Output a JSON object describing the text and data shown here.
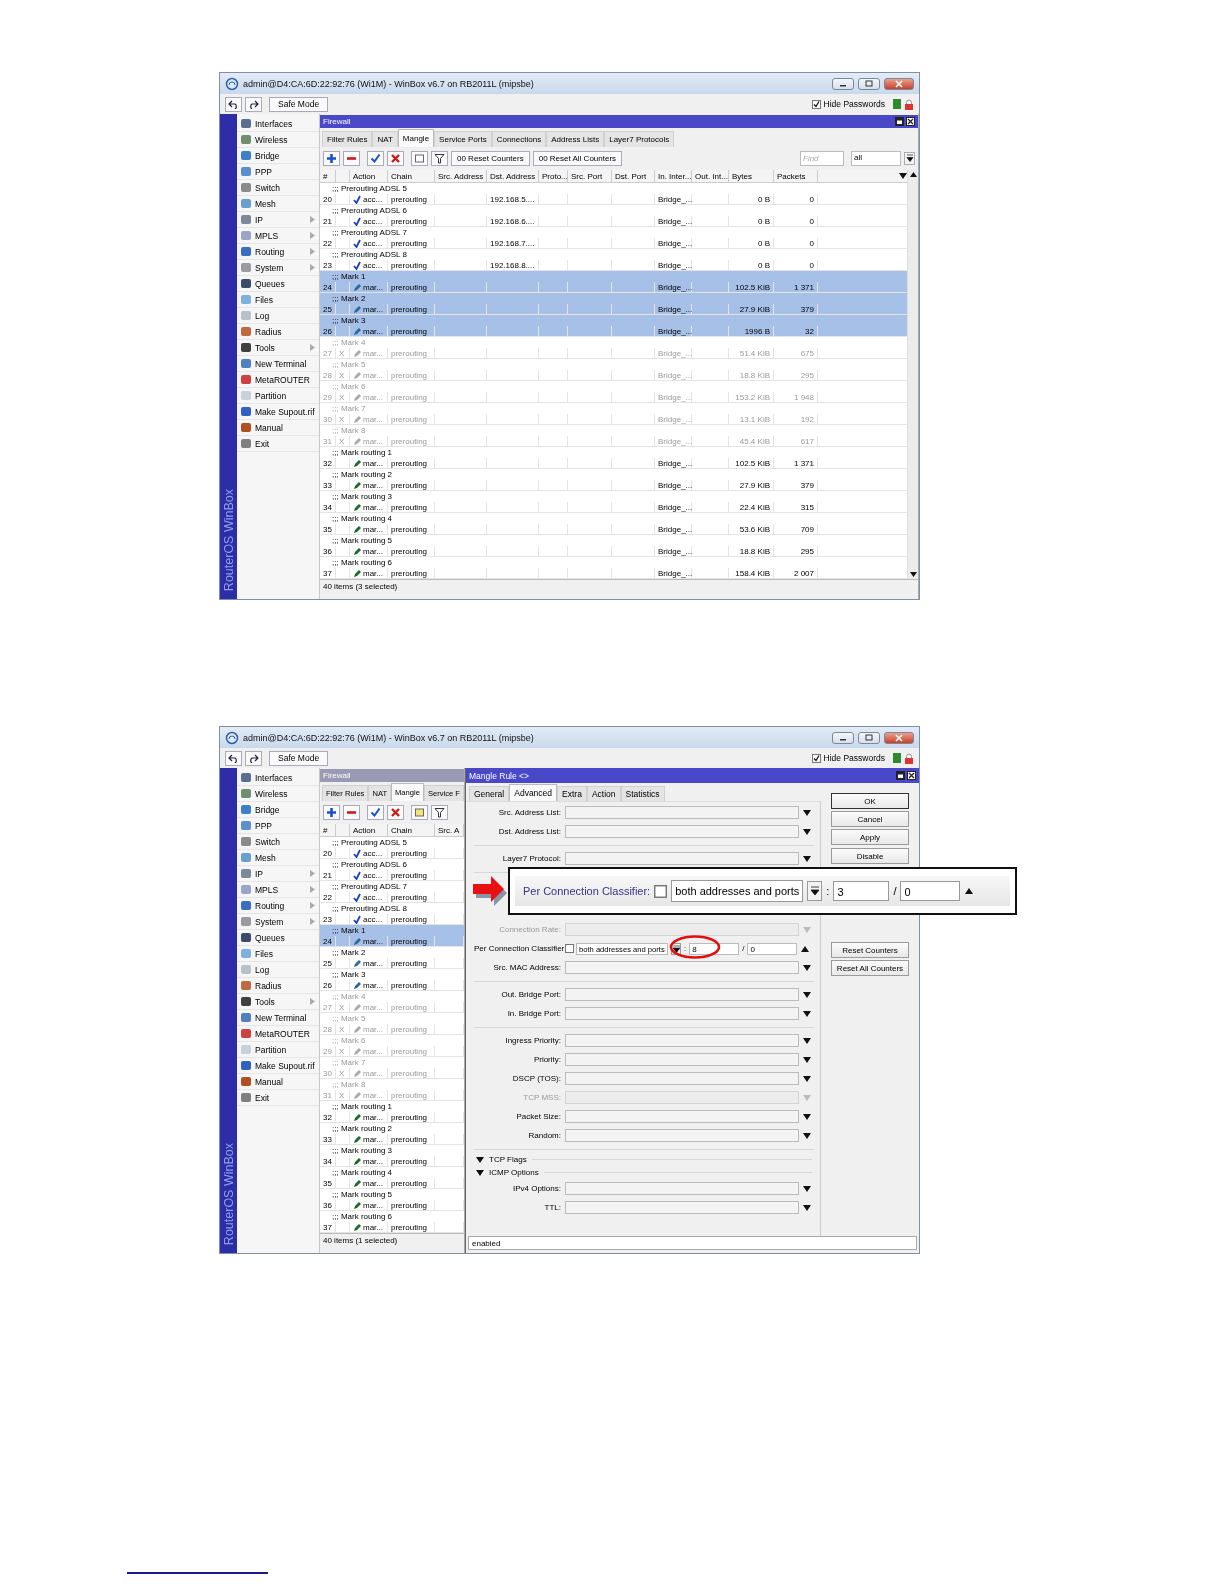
{
  "screenshots": [
    {
      "window": {
        "title": "admin@D4:CA:6D:22:92:76 (Wi1M) - WinBox v6.7 on RB2011L (mipsbe)"
      },
      "toolbar": {
        "safe_mode": "Safe Mode",
        "hide_passwords": {
          "label": "Hide Passwords",
          "checked": true
        }
      },
      "brand": "RouterOS WinBox",
      "menu": [
        {
          "label": "Interfaces",
          "submenu": false
        },
        {
          "label": "Wireless",
          "submenu": false
        },
        {
          "label": "Bridge",
          "submenu": false
        },
        {
          "label": "PPP",
          "submenu": false
        },
        {
          "label": "Switch",
          "submenu": false
        },
        {
          "label": "Mesh",
          "submenu": false
        },
        {
          "label": "IP",
          "submenu": true
        },
        {
          "label": "MPLS",
          "submenu": true
        },
        {
          "label": "Routing",
          "submenu": true
        },
        {
          "label": "System",
          "submenu": true
        },
        {
          "label": "Queues",
          "submenu": false
        },
        {
          "label": "Files",
          "submenu": false
        },
        {
          "label": "Log",
          "submenu": false
        },
        {
          "label": "Radius",
          "submenu": false
        },
        {
          "label": "Tools",
          "submenu": true
        },
        {
          "label": "New Terminal",
          "submenu": false
        },
        {
          "label": "MetaROUTER",
          "submenu": false
        },
        {
          "label": "Partition",
          "submenu": false
        },
        {
          "label": "Make Supout.rif",
          "submenu": false
        },
        {
          "label": "Manual",
          "submenu": false
        },
        {
          "label": "Exit",
          "submenu": false
        }
      ],
      "firewall": {
        "title": "Firewall",
        "active": true,
        "tabs": [
          {
            "label": "Filter Rules",
            "selected": false
          },
          {
            "label": "NAT",
            "selected": false
          },
          {
            "label": "Mangle",
            "selected": true
          },
          {
            "label": "Service Ports",
            "selected": false
          },
          {
            "label": "Connections",
            "selected": false
          },
          {
            "label": "Address Lists",
            "selected": false
          },
          {
            "label": "Layer7 Protocols",
            "selected": false
          }
        ],
        "buttons": [
          "00 Reset Counters",
          "00 Reset All Counters"
        ],
        "find": {
          "placeholder": "Find"
        },
        "filter_value": "all",
        "columns": [
          "#",
          "Action",
          "Chain",
          "Src. Address",
          "Dst. Address",
          "Proto...",
          "Src. Port",
          "Dst. Port",
          "In. Inter...",
          "Out. Int...",
          "Bytes",
          "Packets"
        ],
        "rows": [
          {
            "kind": "comment",
            "text": ";;; Prerouting ADSL 5",
            "selected": false,
            "disabled": false
          },
          {
            "kind": "accept",
            "cells": [
              "20",
              "acc...",
              "prerouting",
              null,
              "192.168.5....",
              null,
              null,
              null,
              "Bridge_...",
              null,
              "0 B",
              "0"
            ],
            "selected": false,
            "disabled": false
          },
          {
            "kind": "comment",
            "text": ";;; Prerouting ADSL 6",
            "selected": false,
            "disabled": false
          },
          {
            "kind": "accept",
            "cells": [
              "21",
              "acc...",
              "prerouting",
              null,
              "192.168.6....",
              null,
              null,
              null,
              "Bridge_...",
              null,
              "0 B",
              "0"
            ],
            "selected": false,
            "disabled": false
          },
          {
            "kind": "comment",
            "text": ";;; Prerouting ADSL 7",
            "selected": false,
            "disabled": false
          },
          {
            "kind": "accept",
            "cells": [
              "22",
              "acc...",
              "prerouting",
              null,
              "192.168.7....",
              null,
              null,
              null,
              "Bridge_...",
              null,
              "0 B",
              "0"
            ],
            "selected": false,
            "disabled": false
          },
          {
            "kind": "comment",
            "text": ";;; Prerouting ADSL 8",
            "selected": false,
            "disabled": false
          },
          {
            "kind": "accept",
            "cells": [
              "23",
              "acc...",
              "prerouting",
              null,
              "192.168.8....",
              null,
              null,
              null,
              "Bridge_...",
              null,
              "0 B",
              "0"
            ],
            "selected": false,
            "disabled": false
          },
          {
            "kind": "comment",
            "text": ";;; Mark 1",
            "selected": true,
            "disabled": false
          },
          {
            "kind": "mark-connection",
            "cells": [
              "24",
              "mar...",
              "prerouting",
              null,
              null,
              null,
              null,
              null,
              "Bridge_...",
              null,
              "102.5 KiB",
              "1 371"
            ],
            "selected": true,
            "disabled": false
          },
          {
            "kind": "comment",
            "text": ";;; Mark 2",
            "selected": true,
            "disabled": false
          },
          {
            "kind": "mark-connection",
            "cells": [
              "25",
              "mar...",
              "prerouting",
              null,
              null,
              null,
              null,
              null,
              "Bridge_...",
              null,
              "27.9 KiB",
              "379"
            ],
            "selected": true,
            "disabled": false
          },
          {
            "kind": "comment",
            "text": ";;; Mark 3",
            "selected": true,
            "disabled": false
          },
          {
            "kind": "mark-connection",
            "cells": [
              "26",
              "mar...",
              "prerouting",
              null,
              null,
              null,
              null,
              null,
              "Bridge_...",
              null,
              "1996 B",
              "32"
            ],
            "selected": true,
            "disabled": false
          },
          {
            "kind": "comment",
            "text": ";;; Mark 4",
            "selected": false,
            "disabled": true
          },
          {
            "kind": "mark-connection",
            "cells": [
              "27",
              "mar...",
              "prerouting",
              null,
              null,
              null,
              null,
              null,
              "Bridge_...",
              null,
              "51.4 KiB",
              "675"
            ],
            "flag": "X",
            "selected": false,
            "disabled": true
          },
          {
            "kind": "comment",
            "text": ";;; Mark 5",
            "selected": false,
            "disabled": true
          },
          {
            "kind": "mark-connection",
            "cells": [
              "28",
              "mar...",
              "prerouting",
              null,
              null,
              null,
              null,
              null,
              "Bridge_...",
              null,
              "18.8 KiB",
              "295"
            ],
            "flag": "X",
            "selected": false,
            "disabled": true
          },
          {
            "kind": "comment",
            "text": ";;; Mark 6",
            "selected": false,
            "disabled": true
          },
          {
            "kind": "mark-connection",
            "cells": [
              "29",
              "mar...",
              "prerouting",
              null,
              null,
              null,
              null,
              null,
              "Bridge_...",
              null,
              "153.2 KiB",
              "1 948"
            ],
            "flag": "X",
            "selected": false,
            "disabled": true
          },
          {
            "kind": "comment",
            "text": ";;; Mark 7",
            "selected": false,
            "disabled": true
          },
          {
            "kind": "mark-connection",
            "cells": [
              "30",
              "mar...",
              "prerouting",
              null,
              null,
              null,
              null,
              null,
              "Bridge_...",
              null,
              "13.1 KiB",
              "192"
            ],
            "flag": "X",
            "selected": false,
            "disabled": true
          },
          {
            "kind": "comment",
            "text": ";;; Mark 8",
            "selected": false,
            "disabled": true
          },
          {
            "kind": "mark-connection",
            "cells": [
              "31",
              "mar...",
              "prerouting",
              null,
              null,
              null,
              null,
              null,
              "Bridge_...",
              null,
              "45.4 KiB",
              "617"
            ],
            "flag": "X",
            "selected": false,
            "disabled": true
          },
          {
            "kind": "comment",
            "text": ";;; Mark routing 1",
            "selected": false,
            "disabled": false
          },
          {
            "kind": "mark-routing",
            "cells": [
              "32",
              "mar...",
              "prerouting",
              null,
              null,
              null,
              null,
              null,
              "Bridge_...",
              null,
              "102.5 KiB",
              "1 371"
            ],
            "selected": false,
            "disabled": false
          },
          {
            "kind": "comment",
            "text": ";;; Mark routing 2",
            "selected": false,
            "disabled": false
          },
          {
            "kind": "mark-routing",
            "cells": [
              "33",
              "mar...",
              "prerouting",
              null,
              null,
              null,
              null,
              null,
              "Bridge_...",
              null,
              "27.9 KiB",
              "379"
            ],
            "selected": false,
            "disabled": false
          },
          {
            "kind": "comment",
            "text": ";;; Mark routing 3",
            "selected": false,
            "disabled": false
          },
          {
            "kind": "mark-routing",
            "cells": [
              "34",
              "mar...",
              "prerouting",
              null,
              null,
              null,
              null,
              null,
              "Bridge_...",
              null,
              "22.4 KiB",
              "315"
            ],
            "selected": false,
            "disabled": false
          },
          {
            "kind": "comment",
            "text": ";;; Mark routing 4",
            "selected": false,
            "disabled": false
          },
          {
            "kind": "mark-routing",
            "cells": [
              "35",
              "mar...",
              "prerouting",
              null,
              null,
              null,
              null,
              null,
              "Bridge_...",
              null,
              "53.6 KiB",
              "709"
            ],
            "selected": false,
            "disabled": false
          },
          {
            "kind": "comment",
            "text": ";;; Mark routing 5",
            "selected": false,
            "disabled": false
          },
          {
            "kind": "mark-routing",
            "cells": [
              "36",
              "mar...",
              "prerouting",
              null,
              null,
              null,
              null,
              null,
              "Bridge_...",
              null,
              "18.8 KiB",
              "295"
            ],
            "selected": false,
            "disabled": false
          },
          {
            "kind": "comment",
            "text": ";;; Mark routing 6",
            "selected": false,
            "disabled": false
          },
          {
            "kind": "mark-routing",
            "cells": [
              "37",
              "mar...",
              "prerouting",
              null,
              null,
              null,
              null,
              null,
              "Bridge_...",
              null,
              "158.4 KiB",
              "2 007"
            ],
            "selected": false,
            "disabled": false
          }
        ],
        "status": "40 items (3 selected)"
      }
    },
    {
      "window": {
        "title": "admin@D4:CA:6D:22:92:76 (Wi1M) - WinBox v6.7 on RB2011L (mipsbe)"
      },
      "toolbar": {
        "safe_mode": "Safe Mode",
        "hide_passwords": {
          "label": "Hide Passwords",
          "checked": true
        }
      },
      "brand": "RouterOS WinBox",
      "menu": [
        {
          "label": "Interfaces",
          "submenu": false
        },
        {
          "label": "Wireless",
          "submenu": false
        },
        {
          "label": "Bridge",
          "submenu": false
        },
        {
          "label": "PPP",
          "submenu": false
        },
        {
          "label": "Switch",
          "submenu": false
        },
        {
          "label": "Mesh",
          "submenu": false
        },
        {
          "label": "IP",
          "submenu": true
        },
        {
          "label": "MPLS",
          "submenu": true
        },
        {
          "label": "Routing",
          "submenu": true
        },
        {
          "label": "System",
          "submenu": true
        },
        {
          "label": "Queues",
          "submenu": false
        },
        {
          "label": "Files",
          "submenu": false
        },
        {
          "label": "Log",
          "submenu": false
        },
        {
          "label": "Radius",
          "submenu": false
        },
        {
          "label": "Tools",
          "submenu": true
        },
        {
          "label": "New Terminal",
          "submenu": false
        },
        {
          "label": "MetaROUTER",
          "submenu": false
        },
        {
          "label": "Partition",
          "submenu": false
        },
        {
          "label": "Make Supout.rif",
          "submenu": false
        },
        {
          "label": "Manual",
          "submenu": false
        },
        {
          "label": "Exit",
          "submenu": false
        }
      ],
      "firewall": {
        "title": "Firewall",
        "active": false,
        "tabs": [
          {
            "label": "Filter Rules",
            "selected": false
          },
          {
            "label": "NAT",
            "selected": false
          },
          {
            "label": "Mangle",
            "selected": true
          },
          {
            "label": "Service F",
            "selected": false
          }
        ],
        "columns": [
          "#",
          "Action",
          "Chain",
          "Src. A"
        ],
        "rows": [
          {
            "kind": "comment",
            "text": ";;; Prerouting ADSL 5",
            "selected": false,
            "disabled": false
          },
          {
            "kind": "accept",
            "cells": [
              "20",
              "acc...",
              "prerouting",
              null
            ],
            "selected": false,
            "disabled": false
          },
          {
            "kind": "comment",
            "text": ";;; Prerouting ADSL 6",
            "selected": false,
            "disabled": false
          },
          {
            "kind": "accept",
            "cells": [
              "21",
              "acc...",
              "prerouting",
              null
            ],
            "selected": false,
            "disabled": false
          },
          {
            "kind": "comment",
            "text": ";;; Prerouting ADSL 7",
            "selected": false,
            "disabled": false
          },
          {
            "kind": "accept",
            "cells": [
              "22",
              "acc...",
              "prerouting",
              null
            ],
            "selected": false,
            "disabled": false
          },
          {
            "kind": "comment",
            "text": ";;; Prerouting ADSL 8",
            "selected": false,
            "disabled": false
          },
          {
            "kind": "accept",
            "cells": [
              "23",
              "acc...",
              "prerouting",
              null
            ],
            "selected": false,
            "disabled": false
          },
          {
            "kind": "comment",
            "text": ";;; Mark 1",
            "selected": true,
            "disabled": false
          },
          {
            "kind": "mark-connection",
            "cells": [
              "24",
              "mar...",
              "prerouting",
              null
            ],
            "selected": true,
            "disabled": false
          },
          {
            "kind": "comment",
            "text": ";;; Mark 2",
            "selected": false,
            "disabled": false
          },
          {
            "kind": "mark-connection",
            "cells": [
              "25",
              "mar...",
              "prerouting",
              null
            ],
            "selected": false,
            "disabled": false
          },
          {
            "kind": "comment",
            "text": ";;; Mark 3",
            "selected": false,
            "disabled": false
          },
          {
            "kind": "mark-connection",
            "cells": [
              "26",
              "mar...",
              "prerouting",
              null
            ],
            "selected": false,
            "disabled": false
          },
          {
            "kind": "comment",
            "text": ";;; Mark 4",
            "selected": false,
            "disabled": true
          },
          {
            "kind": "mark-connection",
            "cells": [
              "27",
              "mar...",
              "prerouting",
              null
            ],
            "flag": "X",
            "selected": false,
            "disabled": true
          },
          {
            "kind": "comment",
            "text": ";;; Mark 5",
            "selected": false,
            "disabled": true
          },
          {
            "kind": "mark-connection",
            "cells": [
              "28",
              "mar...",
              "prerouting",
              null
            ],
            "flag": "X",
            "selected": false,
            "disabled": true
          },
          {
            "kind": "comment",
            "text": ";;; Mark 6",
            "selected": false,
            "disabled": true
          },
          {
            "kind": "mark-connection",
            "cells": [
              "29",
              "mar...",
              "prerouting",
              null
            ],
            "flag": "X",
            "selected": false,
            "disabled": true
          },
          {
            "kind": "comment",
            "text": ";;; Mark 7",
            "selected": false,
            "disabled": true
          },
          {
            "kind": "mark-connection",
            "cells": [
              "30",
              "mar...",
              "prerouting",
              null
            ],
            "flag": "X",
            "selected": false,
            "disabled": true
          },
          {
            "kind": "comment",
            "text": ";;; Mark 8",
            "selected": false,
            "disabled": true
          },
          {
            "kind": "mark-connection",
            "cells": [
              "31",
              "mar...",
              "prerouting",
              null
            ],
            "flag": "X",
            "selected": false,
            "disabled": true
          },
          {
            "kind": "comment",
            "text": ";;; Mark routing 1",
            "selected": false,
            "disabled": false
          },
          {
            "kind": "mark-routing",
            "cells": [
              "32",
              "mar...",
              "prerouting",
              null
            ],
            "selected": false,
            "disabled": false
          },
          {
            "kind": "comment",
            "text": ";;; Mark routing 2",
            "selected": false,
            "disabled": false
          },
          {
            "kind": "mark-routing",
            "cells": [
              "33",
              "mar...",
              "prerouting",
              null
            ],
            "selected": false,
            "disabled": false
          },
          {
            "kind": "comment",
            "text": ";;; Mark routing 3",
            "selected": false,
            "disabled": false
          },
          {
            "kind": "mark-routing",
            "cells": [
              "34",
              "mar...",
              "prerouting",
              null
            ],
            "selected": false,
            "disabled": false
          },
          {
            "kind": "comment",
            "text": ";;; Mark routing 4",
            "selected": false,
            "disabled": false
          },
          {
            "kind": "mark-routing",
            "cells": [
              "35",
              "mar...",
              "prerouting",
              null
            ],
            "selected": false,
            "disabled": false
          },
          {
            "kind": "comment",
            "text": ";;; Mark routing 5",
            "selected": false,
            "disabled": false
          },
          {
            "kind": "mark-routing",
            "cells": [
              "36",
              "mar...",
              "prerouting",
              null
            ],
            "selected": false,
            "disabled": false
          },
          {
            "kind": "comment",
            "text": ";;; Mark routing 6",
            "selected": false,
            "disabled": false
          },
          {
            "kind": "mark-routing",
            "cells": [
              "37",
              "mar...",
              "prerouting",
              null
            ],
            "selected": false,
            "disabled": false
          }
        ],
        "status": "40 items (1 selected)"
      },
      "dialog": {
        "title": "Mangle Rule <>",
        "active": true,
        "tabs": [
          {
            "label": "General",
            "selected": false
          },
          {
            "label": "Advanced",
            "selected": true
          },
          {
            "label": "Extra",
            "selected": false
          },
          {
            "label": "Action",
            "selected": false
          },
          {
            "label": "Statistics",
            "selected": false
          }
        ],
        "groups": [
          [
            {
              "kind": "combo",
              "label": "Src. Address List:",
              "disabled": false
            },
            {
              "kind": "combo",
              "label": "Dst. Address List:",
              "disabled": false
            }
          ],
          [
            {
              "kind": "combo",
              "label": "Layer7 Protocol:",
              "disabled": false
            }
          ],
          [
            {
              "kind": "combo",
              "label": "Connection Rate:",
              "disabled": true
            },
            {
              "kind": "pcc",
              "label": "Per Connection Classifier:",
              "checked": false,
              "select": "both addresses and ports",
              "separator": ":",
              "value": "8",
              "separator2": "/",
              "value2": "0",
              "circled": true
            },
            {
              "kind": "combo",
              "label": "Src. MAC Address:",
              "disabled": false
            }
          ],
          [
            {
              "kind": "combo",
              "label": "Out. Bridge Port:",
              "disabled": false
            },
            {
              "kind": "combo",
              "label": "In. Bridge Port:",
              "disabled": false
            }
          ],
          [
            {
              "kind": "combo",
              "label": "Ingress Priority:",
              "disabled": false
            },
            {
              "kind": "combo",
              "label": "Priority:",
              "disabled": false
            },
            {
              "kind": "combo",
              "label": "DSCP (TOS):",
              "disabled": false
            },
            {
              "kind": "combo",
              "label": "TCP MSS:",
              "disabled": true
            },
            {
              "kind": "combo",
              "label": "Packet Size:",
              "disabled": false
            },
            {
              "kind": "combo",
              "label": "Random:",
              "disabled": false
            }
          ],
          [
            {
              "kind": "section",
              "label": "TCP Flags"
            },
            {
              "kind": "section",
              "label": "ICMP Options"
            },
            {
              "kind": "combo",
              "label": "IPv4 Options:",
              "disabled": false
            },
            {
              "kind": "combo",
              "label": "TTL:",
              "disabled": false
            }
          ]
        ],
        "buttons": [
          "OK",
          "Cancel",
          "Apply",
          "Disable",
          "Reset Counters",
          "Reset All Counters"
        ],
        "status": "enabled"
      },
      "callout": {
        "label": "Per Connection Classifier:",
        "checked": false,
        "select": "both addresses and ports",
        "separator": ":",
        "value": "3",
        "separator2": "/",
        "value2": "0"
      }
    }
  ]
}
